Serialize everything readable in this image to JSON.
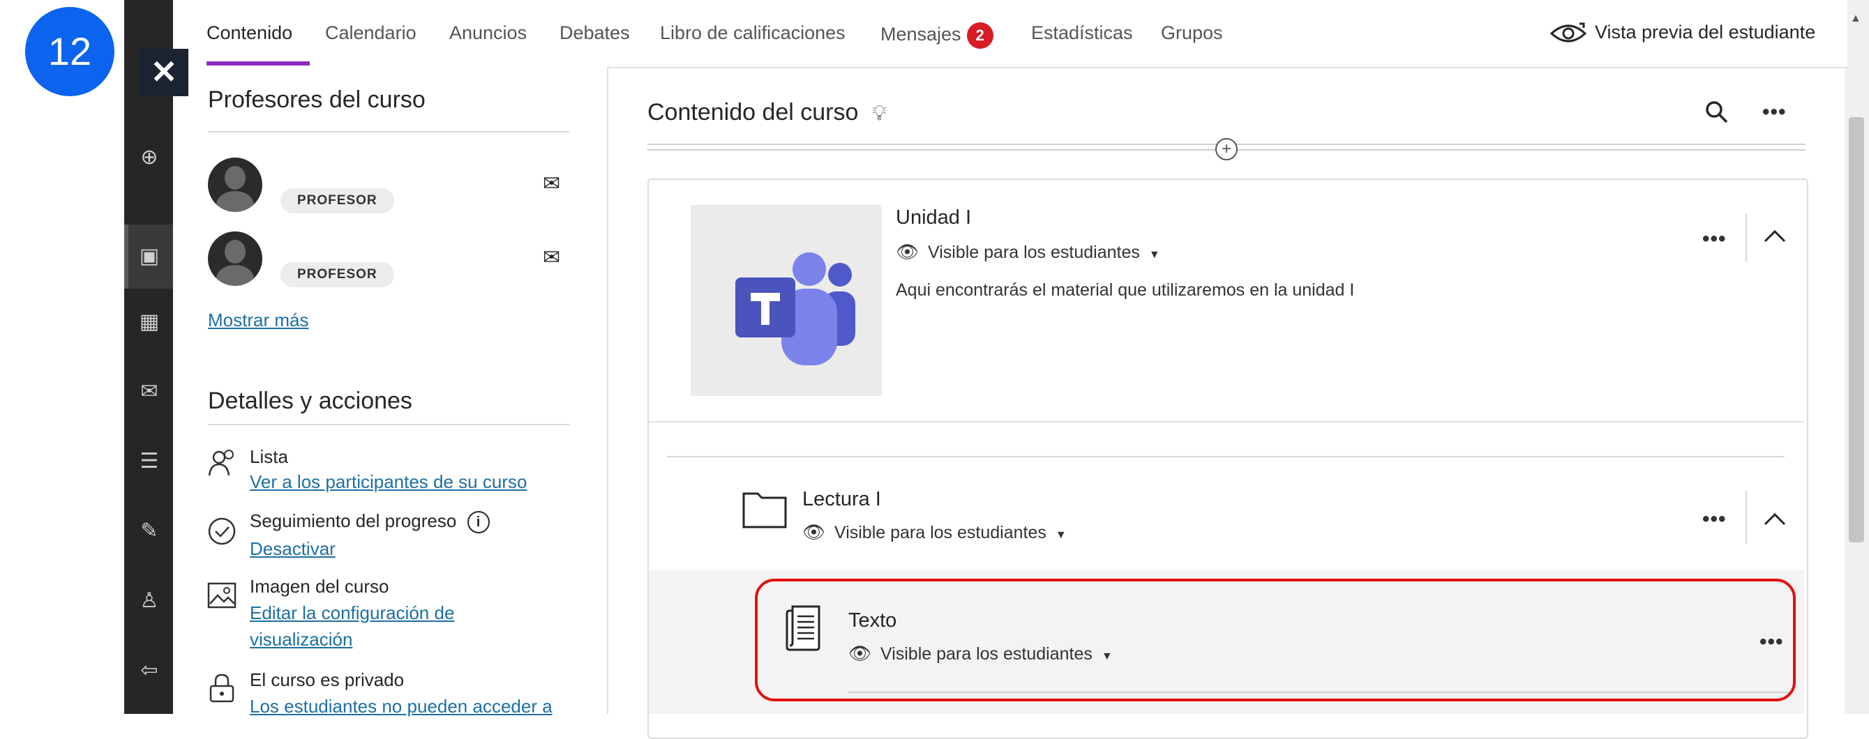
{
  "step_badge": "12",
  "close_glyph": "✕",
  "tabs": [
    {
      "label": "Contenido"
    },
    {
      "label": "Calendario"
    },
    {
      "label": "Anuncios"
    },
    {
      "label": "Debates"
    },
    {
      "label": "Libro de calificaciones"
    },
    {
      "label": "Mensajes",
      "badge": "2"
    },
    {
      "label": "Estadísticas"
    },
    {
      "label": "Grupos"
    }
  ],
  "student_preview": "Vista previa del estudiante",
  "left_panel": {
    "professors_title": "Profesores del curso",
    "professor_role": "PROFESOR",
    "show_more": "Mostrar más",
    "details_title": "Detalles y acciones",
    "items": [
      {
        "title": "Lista",
        "link": "Ver a los participantes de su curso",
        "icon": "roster-icon"
      },
      {
        "title": "Seguimiento del progreso",
        "link": "Desactivar",
        "icon": "progress-check-icon"
      },
      {
        "title": "Imagen del curso",
        "link_line1": "Editar la configuración de",
        "link_line2": "visualización",
        "icon": "image-icon"
      },
      {
        "title": "El curso es privado",
        "link": "Los estudiantes no pueden acceder a",
        "icon": "lock-icon"
      }
    ]
  },
  "main": {
    "title": "Contenido del curso",
    "unit": {
      "title": "Unidad I",
      "visibility": "Visible para los estudiantes",
      "description": "Aqui encontrarás el material que utilizaremos en la unidad I"
    },
    "folder": {
      "title": "Lectura I",
      "visibility": "Visible para los estudiantes"
    },
    "document": {
      "title": "Texto",
      "visibility": "Visible para los estudiantes"
    }
  },
  "colors": {
    "accent_tab": "#8b2cc4",
    "badge_red": "#d81b24",
    "step_blue": "#0b63ee",
    "highlight_red": "#e01010",
    "teams_purple": "#5b5fc7"
  }
}
